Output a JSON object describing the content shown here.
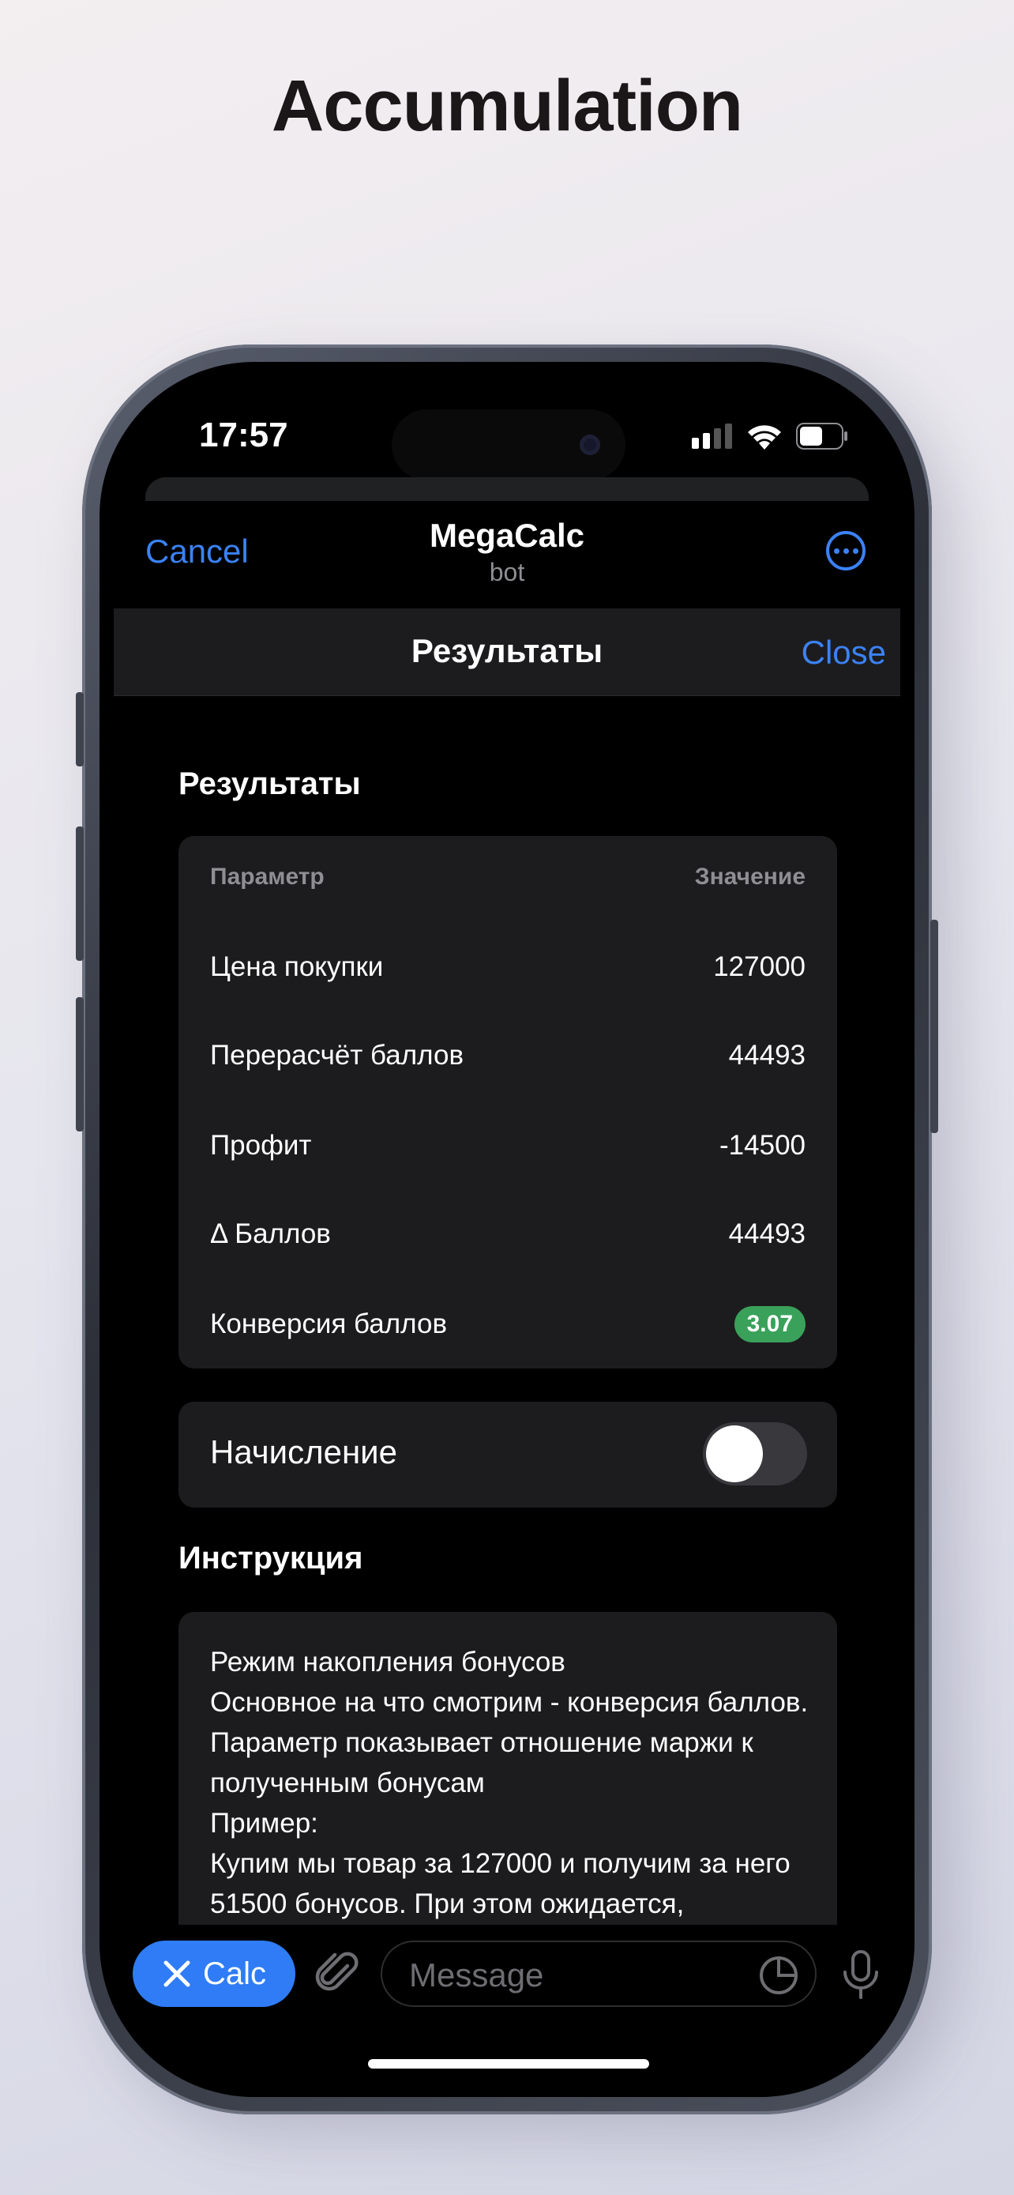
{
  "headline": "Accumulation",
  "status_bar": {
    "time": "17:57",
    "battery_level": 0.55
  },
  "nav": {
    "cancel_label": "Cancel",
    "title": "MegaCalc",
    "subtitle": "bot",
    "more_icon": "ellipsis-circle-icon"
  },
  "webapp_header": {
    "title": "Результаты",
    "close_label": "Close"
  },
  "results": {
    "section_title": "Результаты",
    "columns": [
      "Параметр",
      "Значение"
    ],
    "rows": [
      {
        "label": "Цена покупки",
        "value": "127000"
      },
      {
        "label": "Перерасчёт баллов",
        "value": "44493"
      },
      {
        "label": "Профит",
        "value": "-14500"
      },
      {
        "label": "Δ Баллов",
        "value": "44493"
      },
      {
        "label": "Конверсия баллов",
        "value": "3.07"
      }
    ],
    "badge_color": "#3aa15a"
  },
  "accrual": {
    "label": "Начисление",
    "enabled": false
  },
  "instruction": {
    "section_title": "Инструкция",
    "text": "Режим накопления бонусов\nОсновное на что смотрим - конверсия баллов. Параметр показывает отношение маржи к полученным бонусам\nПример:\nКупим мы товар за 127000 и получим за него 51500 бонусов. При этом ожидается,"
  },
  "input_bar": {
    "calc_label": "Calc",
    "placeholder": "Message",
    "icons": [
      "close-x-icon",
      "paperclip-icon",
      "sticker-icon",
      "microphone-icon"
    ]
  },
  "accent_color": "#3b82f6"
}
